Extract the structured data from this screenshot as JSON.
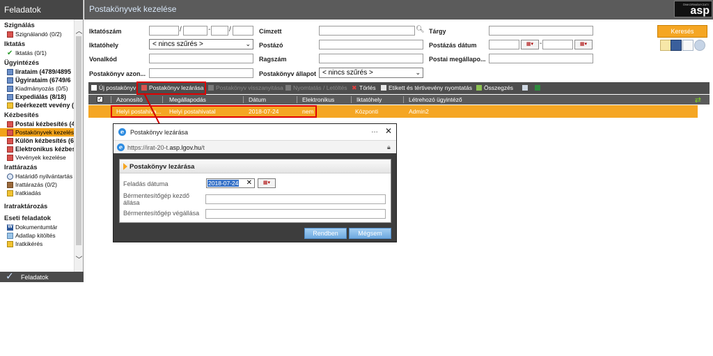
{
  "sidebar": {
    "header": "Feladatok",
    "footer": "Feladatok",
    "groups": {
      "szignalas": {
        "title": "Szignálás",
        "items": [
          "Szignálandó (0/2)"
        ]
      },
      "iktatas": {
        "title": "Iktatás",
        "items": [
          "Iktatás (0/1)"
        ]
      },
      "ugyintezes": {
        "title": "Ügyintézés",
        "items": [
          "Iirataim (4789/4895",
          "Ügyirataim (6749/6",
          "Kiadmányozás (0/5)",
          "Expediálás (8/18)",
          "Beérkezett vevény ("
        ]
      },
      "kezbesites": {
        "title": "Kézbesítés",
        "items": [
          "Postai kézbesítés (4",
          "Postakönyvek kezelése",
          "Külön kézbesítés (6:",
          "Elektronikus kézbes",
          "Vevények kezelése"
        ]
      },
      "irattarazas": {
        "title": "Irattárazás",
        "items": [
          "Határidő nyilvántartás",
          "Irattárazás (0/2)",
          "Iratkiadás"
        ]
      },
      "iratraktarozas": {
        "title": "Iratraktározás"
      },
      "eseti": {
        "title": "Eseti feladatok",
        "items": [
          "Dokumentumtár",
          "Adatlap kitöltés",
          "Iratkikérés"
        ]
      }
    }
  },
  "main": {
    "title": "Postakönyvek kezelése",
    "logo": {
      "small": "ÖNKORMÁNYZATI",
      "big": "asp"
    }
  },
  "filters": {
    "iktatoszam": "Iktatószám",
    "iktatohely": "Iktatóhely",
    "iktatohely_value": "< nincs szűrés >",
    "vonalkod": "Vonalkód",
    "postakonyv_azon": "Postakönyv azon...",
    "cimzett": "Címzett",
    "postazo": "Postázó",
    "ragszam": "Ragszám",
    "postakonyv_allapot": "Postakönyv állapot",
    "postakonyv_allapot_value": "< nincs szűrés >",
    "targy": "Tárgy",
    "postazas_datum": "Postázás dátum",
    "postai_megallapo": "Postai megállapo...",
    "search_button": "Keresés"
  },
  "toolbar": {
    "new": "Új postakönyv",
    "close": "Postakönyv lezárása",
    "reopen": "Postakönyv visszanyitása",
    "print": "Nyomtatás / Letöltés",
    "delete": "Törlés",
    "labels": "Etikett és tértivevény nyomtatás",
    "summary": "Összegzés"
  },
  "grid": {
    "columns": [
      "Azonosító",
      "Megállapodás",
      "Dátum",
      "Elektronikus",
      "Iktatóhely",
      "Létrehozó ügyintéző"
    ],
    "rows": [
      [
        "Helyi postahiva...",
        "Helyi postahivatal",
        "2018-07-24",
        "nem",
        "Központi",
        "Admin2"
      ]
    ]
  },
  "dialog": {
    "window_title": "Postakönyv lezárása",
    "url_prefix": "https://irat-20-t.",
    "url_domain": "asp.lgov.hu",
    "url_suffix": "/t",
    "panel_title": "Postakönyv lezárása",
    "feladas_datuma_label": "Feladás dátuma",
    "feladas_datuma_value": "2018-07-24",
    "kezdo_label": "Bérmentesítőgép kezdő állása",
    "vegallasa_label": "Bérmentesítőgép végállása",
    "ok_button": "Rendben",
    "cancel_button": "Mégsem"
  },
  "colors": {
    "accent_orange": "#f5a623",
    "highlight_red": "#e00000",
    "header_dark": "#464646"
  }
}
